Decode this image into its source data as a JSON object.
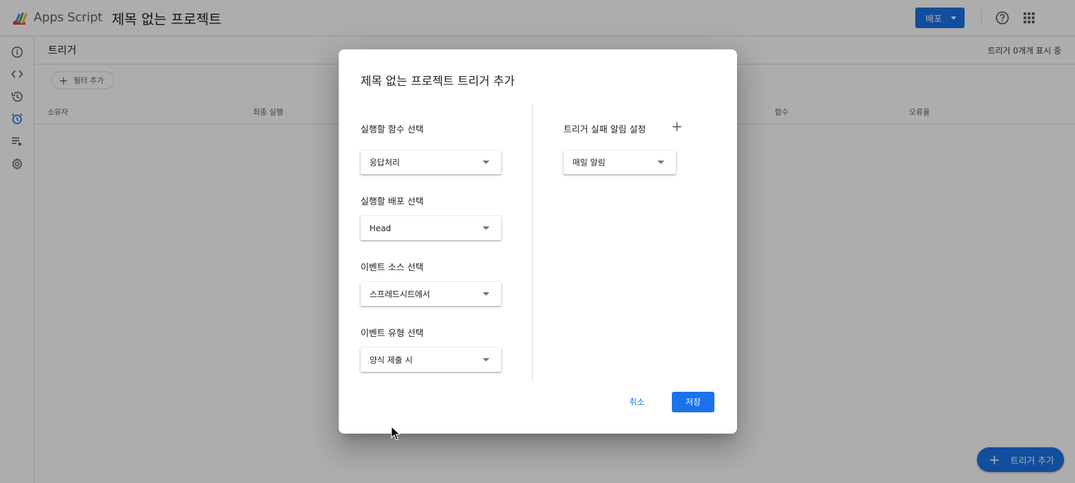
{
  "header": {
    "app_name": "Apps Script",
    "project_title": "제목 없는 프로젝트",
    "deploy_label": "배포"
  },
  "sidebar": {
    "items": [
      {
        "icon": "info-icon"
      },
      {
        "icon": "code-icon"
      },
      {
        "icon": "history-icon"
      },
      {
        "icon": "alarm-clock-icon",
        "active": true
      },
      {
        "icon": "executions-icon"
      },
      {
        "icon": "gear-icon"
      }
    ]
  },
  "main": {
    "title": "트리거",
    "count_text": "트리거 0개개 표시 중",
    "filter_label": "필터 추가",
    "columns": [
      "소유자",
      "최종 실행",
      "함수",
      "오류율"
    ],
    "fab_label": "트리거 추가"
  },
  "dialog": {
    "title": "제목 없는 프로젝트 트리거 추가",
    "function_label": "실행할 함수 선택",
    "function_value": "응답처리",
    "deployment_label": "실행할 배포 선택",
    "deployment_value": "Head",
    "event_source_label": "이벤트 소스 선택",
    "event_source_value": "스프레드시트에서",
    "event_type_label": "이벤트 유형 선택",
    "event_type_value": "양식 제출 시",
    "notification_label": "트리거 실패 알림 설정",
    "notification_value": "매일 알림",
    "cancel_label": "취소",
    "save_label": "저장"
  },
  "colors": {
    "primary": "#1a73e8",
    "scrim": "rgba(0,0,0,0.32)",
    "active_icon": "#1a73e8"
  }
}
